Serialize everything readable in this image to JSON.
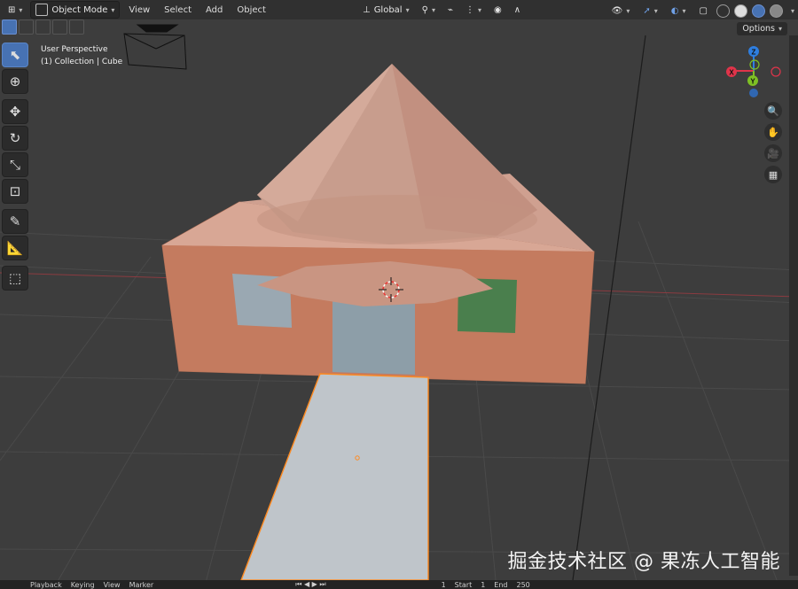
{
  "header": {
    "mode_label": "Object Mode",
    "menu": [
      "View",
      "Select",
      "Add",
      "Object"
    ],
    "transform_orientation": "Global"
  },
  "overlay": {
    "perspective": "User Perspective",
    "collection": "(1) Collection | Cube"
  },
  "options_label": "Options",
  "gizmo": {
    "x": "X",
    "y": "Y",
    "z": "Z"
  },
  "timeline": {
    "playback": "Playback",
    "keying": "Keying",
    "view": "View",
    "marker": "Marker",
    "start_label": "Start",
    "end_label": "End",
    "frame": "1",
    "start": "1",
    "end": "250"
  },
  "watermark": "掘金技术社区 @ 果冻人工智能",
  "colors": {
    "accent": "#4772b3",
    "walls": "#c77f63",
    "roof": "#c99a88",
    "selection": "#ff8a1f",
    "axis_x": "#e0344a",
    "axis_y": "#7ec024",
    "axis_z": "#2e7ee0"
  },
  "tools": [
    "select-box-icon",
    "cursor-icon",
    "move-icon",
    "rotate-icon",
    "scale-icon",
    "transform-icon",
    "annotate-icon",
    "measure-icon",
    "add-cube-icon"
  ]
}
